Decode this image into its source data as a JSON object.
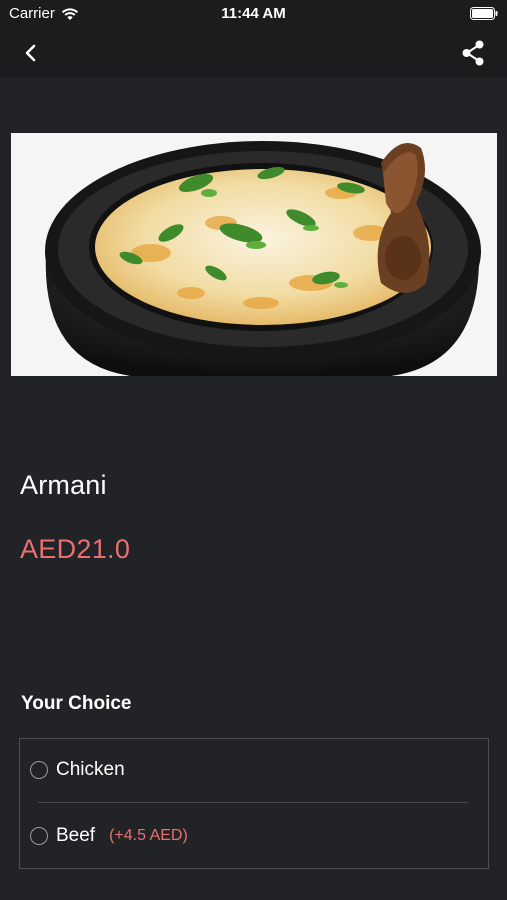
{
  "status_bar": {
    "carrier": "Carrier",
    "time": "11:44 AM"
  },
  "nav": {
    "back_icon": "chevron-left-icon",
    "share_icon": "share-icon"
  },
  "item": {
    "name": "Armani",
    "price": "AED21.0"
  },
  "choice": {
    "heading": "Your Choice",
    "options": [
      {
        "label": "Chicken",
        "extra": ""
      },
      {
        "label": "Beef",
        "extra": "(+4.5 AED)"
      }
    ]
  },
  "colors": {
    "background": "#222326",
    "bar": "#1b1c1e",
    "accent": "#e8716f"
  }
}
